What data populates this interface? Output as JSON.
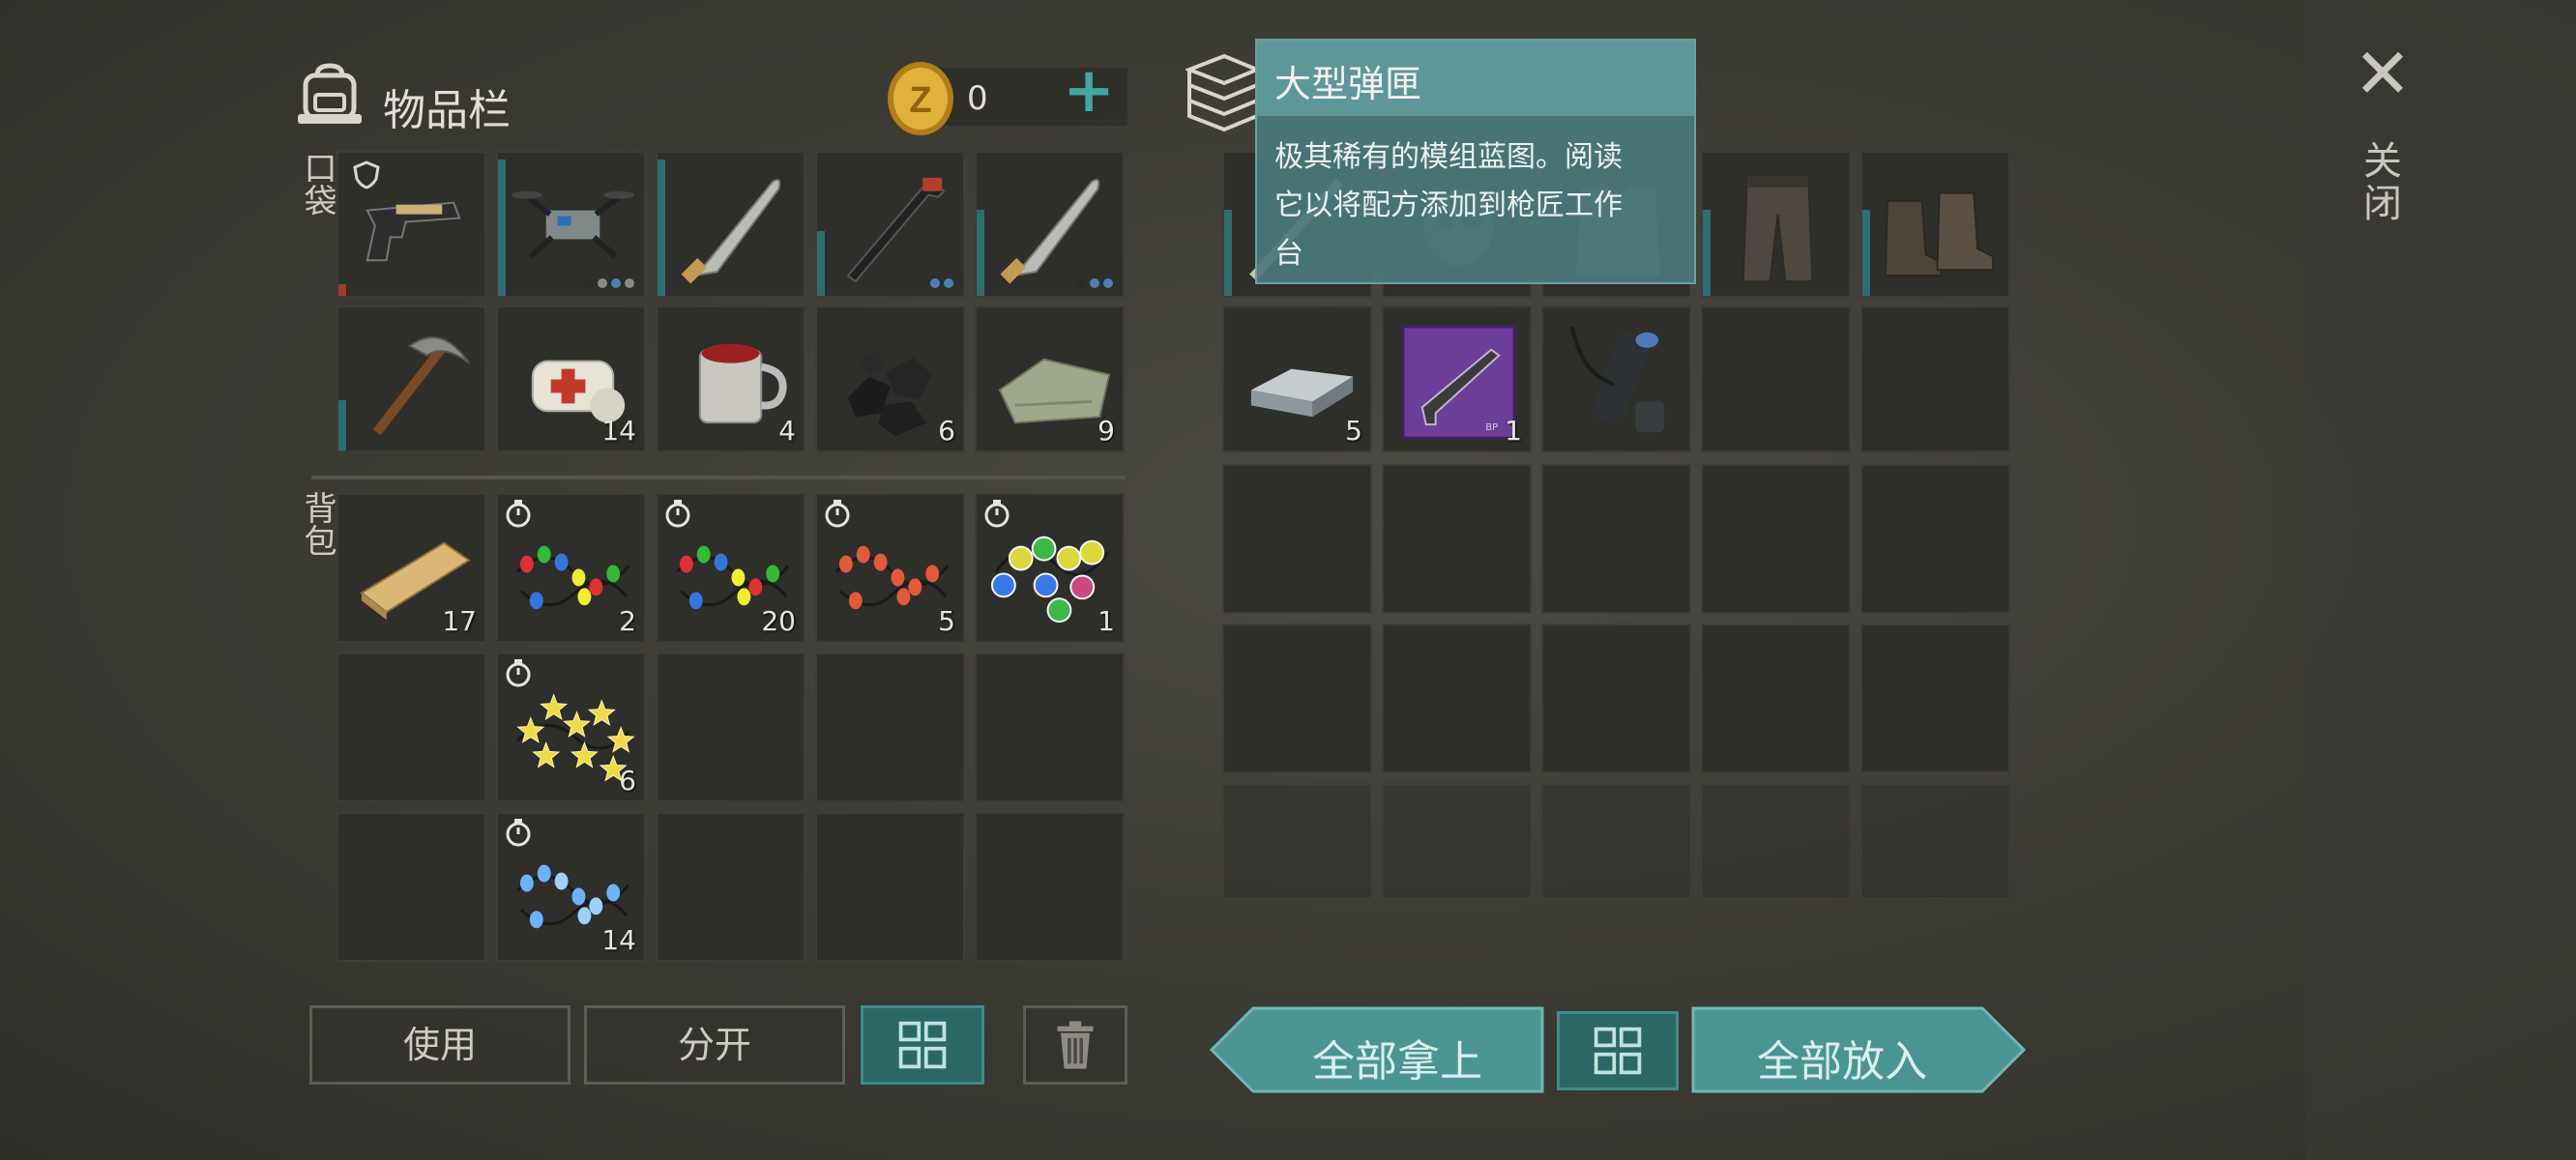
{
  "inventory": {
    "title": "物品栏",
    "coins": "0",
    "pockets_label": "口袋",
    "backpack_label": "背包",
    "pocket_slots": [
      {
        "icon": "pistol-icon",
        "bar_color": "#a53b2c",
        "bar_level": 0.08,
        "shield": true
      },
      {
        "icon": "drone-icon",
        "bar_level": 0.95,
        "dots": [
          "#2a2a28",
          "#8b8b86",
          "#4c7fb5",
          "#8b8b86"
        ]
      },
      {
        "icon": "machete-icon",
        "bar_level": 0.95
      },
      {
        "icon": "crowbar-icon",
        "bar_level": 0.45,
        "dots": [
          "#4c7fb5",
          "#4c7fb5"
        ]
      },
      {
        "icon": "machete-icon",
        "bar_level": 0.6,
        "dots": [
          "#2a2a28",
          "#4c7fb5",
          "#4c7fb5"
        ]
      },
      {
        "icon": "pickaxe-icon",
        "bar_level": 0.35
      },
      {
        "icon": "bandage-icon",
        "count": "14"
      },
      {
        "icon": "mug-icon",
        "count": "4"
      },
      {
        "icon": "coal-icon",
        "count": "6"
      },
      {
        "icon": "cloth-icon",
        "count": "9"
      }
    ],
    "backpack_slots": [
      {
        "icon": "wood-plank-icon",
        "count": "17"
      },
      {
        "icon": "string-lights-icon",
        "count": "2",
        "timer": true
      },
      {
        "icon": "string-lights-icon",
        "count": "20",
        "timer": true
      },
      {
        "icon": "red-lights-icon",
        "count": "5",
        "timer": true
      },
      {
        "icon": "bulb-lights-icon",
        "count": "1",
        "timer": true
      },
      {
        "icon": "empty"
      },
      {
        "icon": "star-lights-icon",
        "count": "6",
        "timer": true
      },
      {
        "icon": "empty"
      },
      {
        "icon": "empty"
      },
      {
        "icon": "empty"
      },
      {
        "icon": "empty"
      },
      {
        "icon": "blue-lights-icon",
        "count": "14",
        "timer": true
      },
      {
        "icon": "empty"
      },
      {
        "icon": "empty"
      },
      {
        "icon": "empty"
      }
    ],
    "buttons": {
      "use": "使用",
      "split": "分开"
    }
  },
  "storage": {
    "slots_row1": [
      {
        "icon": "blade-icon",
        "bar_level": 0.6
      },
      {
        "icon": "mask-icon"
      },
      {
        "icon": "vest-icon"
      },
      {
        "icon": "pants-icon",
        "bar_level": 0.6
      },
      {
        "icon": "boots-icon",
        "bar_level": 0.6
      }
    ],
    "slots_row2": [
      {
        "icon": "metal-ingot-icon",
        "count": "5"
      },
      {
        "icon": "blueprint-icon",
        "count": "1"
      },
      {
        "icon": "magazine-icon"
      },
      {
        "icon": "empty"
      },
      {
        "icon": "empty"
      }
    ],
    "buttons": {
      "take_all": "全部拿上",
      "put_all": "全部放入"
    }
  },
  "tooltip": {
    "title": "大型弹匣",
    "description_line1": "极其稀有的模组蓝图。阅读",
    "description_line2": "它以将配方添加到枪匠工作",
    "description_line3": "台"
  },
  "close_label": "关闭",
  "colors": {
    "teal": "#3fa8a0",
    "slot_bg": "#2e2e2b",
    "durability": "#2f6d70"
  }
}
